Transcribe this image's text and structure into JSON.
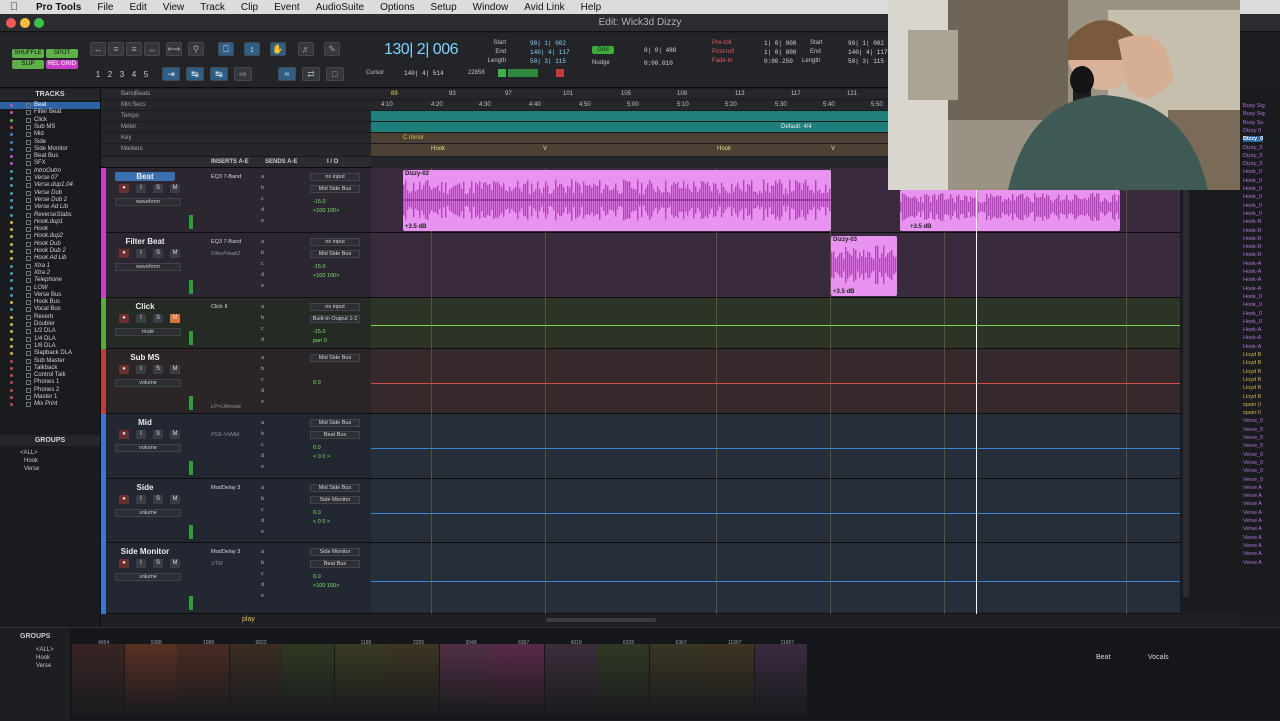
{
  "menu": {
    "app": "Pro Tools",
    "items": [
      "File",
      "Edit",
      "View",
      "Track",
      "Clip",
      "Event",
      "AudioSuite",
      "Options",
      "Setup",
      "Window",
      "Avid Link",
      "Help"
    ]
  },
  "window": {
    "title": "Edit: Wick3d Dizzy"
  },
  "toolbar": {
    "modes": [
      "SHUFFLE",
      "SPOT",
      "SLIP",
      "REL GRID"
    ],
    "zoom_presets": [
      "1",
      "2",
      "3",
      "4",
      "5"
    ],
    "main_counter": "130| 2| 006",
    "cursor_label": "Cursor",
    "cursor_value": "140| 4| 514",
    "sample_value": "22858",
    "sel_labels": [
      "Start",
      "End",
      "Length"
    ],
    "sel_values": [
      "90| 1| 002",
      "140| 4| 117",
      "50| 3| 115"
    ],
    "grid_label": "Grid",
    "grid_value": "0| 0| 480",
    "nudge_label": "Nudge",
    "nudge_value": "0:00.010",
    "preroll_labels": [
      "Pre-roll",
      "Post-roll",
      "Fade-in"
    ],
    "preroll_values": [
      "1| 0| 000",
      "1| 0| 000",
      "0:00.250"
    ],
    "sel2_labels": [
      "Start",
      "End",
      "Length"
    ],
    "sel2_values": [
      "90| 1| 002",
      "140| 4| 117",
      "50| 3| 115"
    ]
  },
  "tracks_panel": {
    "title": "TRACKS",
    "items": [
      {
        "name": "Beat",
        "color": "#d04ad0",
        "selected": true
      },
      {
        "name": "Filter Beat",
        "color": "#d04ad0"
      },
      {
        "name": "Click",
        "color": "#6fbf3a"
      },
      {
        "name": "Sub MS",
        "color": "#c94a4a"
      },
      {
        "name": "Mid",
        "color": "#3f7fd6"
      },
      {
        "name": "Side",
        "color": "#3f7fd6"
      },
      {
        "name": "Side Monitor",
        "color": "#3f7fd6"
      },
      {
        "name": "Beat Bus",
        "color": "#d04ad0"
      },
      {
        "name": "SFX",
        "color": "#d04ad0"
      },
      {
        "name": "IntroOutro",
        "color": "#3aa0b8",
        "italic": true
      },
      {
        "name": "Verse 07",
        "color": "#3aa0b8",
        "italic": true
      },
      {
        "name": "Verse.dup1.04",
        "color": "#3aa0b8",
        "italic": true
      },
      {
        "name": "Verse Dub",
        "color": "#3aa0b8",
        "italic": true
      },
      {
        "name": "Verse Dub 2",
        "color": "#3aa0b8",
        "italic": true
      },
      {
        "name": "Verse Ad Lib",
        "color": "#3aa0b8",
        "italic": true
      },
      {
        "name": "ReverseStabs",
        "color": "#3aa0b8",
        "italic": true
      },
      {
        "name": "Hook.dup1",
        "color": "#d4b83a",
        "italic": true
      },
      {
        "name": "Hook",
        "color": "#d4b83a",
        "italic": true
      },
      {
        "name": "Hook.dup2",
        "color": "#d4b83a",
        "italic": true
      },
      {
        "name": "Hook Dub",
        "color": "#d4b83a",
        "italic": true
      },
      {
        "name": "Hook Dub 2",
        "color": "#d4b83a",
        "italic": true
      },
      {
        "name": "Hook Ad Lib",
        "color": "#d4b83a",
        "italic": true
      },
      {
        "name": "Xtra 1",
        "color": "#3aa0b8",
        "italic": true
      },
      {
        "name": "Xtra 2",
        "color": "#3aa0b8",
        "italic": true
      },
      {
        "name": "Telephone",
        "color": "#3aa0b8",
        "italic": true
      },
      {
        "name": "LOW",
        "color": "#3aa0b8",
        "italic": true
      },
      {
        "name": "Verse Bus",
        "color": "#3aa0b8"
      },
      {
        "name": "Hook Bus",
        "color": "#d4b83a"
      },
      {
        "name": "Vocal Bus",
        "color": "#3aa0b8"
      },
      {
        "name": "Reverb",
        "color": "#d4b83a"
      },
      {
        "name": "Doubler",
        "color": "#d4b83a"
      },
      {
        "name": "1/2 DLA",
        "color": "#d4b83a"
      },
      {
        "name": "1/4 DLA",
        "color": "#d4b83a"
      },
      {
        "name": "1/8 DLA",
        "color": "#d4b83a"
      },
      {
        "name": "Slapback DLA",
        "color": "#d4b83a"
      },
      {
        "name": "Sub Master",
        "color": "#c94a4a"
      },
      {
        "name": "Talkback",
        "color": "#c94a4a"
      },
      {
        "name": "Control Talk",
        "color": "#c94a4a"
      },
      {
        "name": "Phones 1",
        "color": "#c94a4a"
      },
      {
        "name": "Phones 2",
        "color": "#c94a4a"
      },
      {
        "name": "Master 1",
        "color": "#c94a4a"
      },
      {
        "name": "Mix Print",
        "color": "#c94a4a",
        "italic": true
      }
    ]
  },
  "groups_panel": {
    "title": "GROUPS",
    "items": [
      "<ALL>",
      "Hook",
      "Verse"
    ]
  },
  "rulers": {
    "labels": [
      "Bars|Beats",
      "Min:Secs",
      "Tempo",
      "Meter",
      "Key",
      "Markers"
    ],
    "bars": [
      "89",
      "93",
      "97",
      "101",
      "105",
      "109",
      "113",
      "117",
      "121"
    ],
    "times": [
      "4:10",
      "4:20",
      "4:30",
      "4:40",
      "4:50",
      "5:00",
      "5:10",
      "5:20",
      "5:30",
      "5:40",
      "5:50"
    ],
    "meter_text": "Default: 4/4",
    "key_text": "C minor",
    "markers": [
      "Hook",
      "V",
      "Hook",
      "V"
    ]
  },
  "column_heads": [
    "INSERTS A-E",
    "SENDS A-E",
    "I / O"
  ],
  "tracks": [
    {
      "name": "Beat",
      "color": "#c541c8",
      "plugin": "EQ3 7-Band",
      "input": "no input",
      "output": "Mid Side Bus",
      "view": "waveform",
      "vol": "-15.0",
      "pan": "<100  100>",
      "lane_color": "#3a2a3d"
    },
    {
      "name": "Filter Beat",
      "color": "#c541c8",
      "plugin": "EQ3 7-Band",
      "plugin2": "FilterFreak2",
      "input": "no input",
      "output": "Mid Side Bus",
      "view": "waveform",
      "vol": "-15.0",
      "pan": "<100  100>",
      "lane_color": "#3a2a3d"
    },
    {
      "name": "Click",
      "color": "#5fa83a",
      "plugin": "Click II",
      "input": "no input",
      "output": "Built-In Output 1-2",
      "view": "mute",
      "vol": "-15.0",
      "pan": "pan    0",
      "lane_color": "#2c3327"
    },
    {
      "name": "Sub MS",
      "color": "#b84040",
      "plugin": "",
      "plugin2": "LP+Ultimate",
      "input": "Mid Side Bus",
      "output": "",
      "view": "volume",
      "vol": "0.0",
      "pan": "",
      "lane_color": "#35292b"
    },
    {
      "name": "Mid",
      "color": "#3a78c8",
      "plugin": "",
      "plugin2": "PSE-VxMid",
      "input": "Mid Side Bus",
      "output": "Beat Bus",
      "view": "volume",
      "vol": "0.0",
      "pan": "< 0  0 >",
      "lane_color": "#262e3a"
    },
    {
      "name": "Side",
      "color": "#3a78c8",
      "plugin": "ModDelay 3",
      "input": "Mid Side Bus",
      "output": "Side Monitor",
      "view": "volume",
      "vol": "0.0",
      "pan": "< 0  0 >",
      "lane_color": "#262e3a"
    },
    {
      "name": "Side Monitor",
      "color": "#3a78c8",
      "plugin": "ModDelay 3",
      "plugin2": "VTM",
      "input": "Side Monitor",
      "output": "Beat Bus",
      "view": "volume",
      "vol": "0.0",
      "pan": "<100  100>",
      "lane_color": "#262e3a"
    }
  ],
  "clips": [
    {
      "name": "Dizzy-02",
      "gain": "+3.5 dB"
    },
    {
      "name": "Dizzy-03",
      "gain": "+3.5 dB"
    },
    {
      "name": "",
      "gain": "+3.5 dB"
    }
  ],
  "right_list": {
    "items": [
      {
        "t": "Busy Sig",
        "c": "#b574d6"
      },
      {
        "t": "Busy Sig",
        "c": "#b574d6"
      },
      {
        "t": "Busy Su",
        "c": "#b574d6"
      },
      {
        "t": "Dizzy (I",
        "c": "#b574d6"
      },
      {
        "t": "Dizzy_0",
        "c": "#fff",
        "sel": true
      },
      {
        "t": "Dizzy_0",
        "c": "#b574d6"
      },
      {
        "t": "Dizzy_0",
        "c": "#b574d6"
      },
      {
        "t": "Dizzy_0",
        "c": "#b574d6"
      },
      {
        "t": "Hook_0",
        "c": "#b574d6"
      },
      {
        "t": "Hook_0",
        "c": "#b574d6"
      },
      {
        "t": "Hook_0",
        "c": "#b574d6"
      },
      {
        "t": "Hook_0",
        "c": "#b574d6"
      },
      {
        "t": "Hook_0",
        "c": "#b574d6"
      },
      {
        "t": "Hook_0",
        "c": "#b574d6"
      },
      {
        "t": "Hook-R",
        "c": "#b574d6"
      },
      {
        "t": "Hook-R",
        "c": "#b574d6"
      },
      {
        "t": "Hook-R",
        "c": "#b574d6"
      },
      {
        "t": "Hook-R",
        "c": "#b574d6"
      },
      {
        "t": "Hook-R",
        "c": "#b574d6"
      },
      {
        "t": "Hook-A",
        "c": "#b574d6"
      },
      {
        "t": "Hook-A",
        "c": "#b574d6"
      },
      {
        "t": "Hook-A",
        "c": "#b574d6"
      },
      {
        "t": "Hook-A",
        "c": "#b574d6"
      },
      {
        "t": "Hook_0",
        "c": "#b574d6"
      },
      {
        "t": "Hook_0",
        "c": "#b574d6"
      },
      {
        "t": "Hook_0",
        "c": "#b574d6"
      },
      {
        "t": "Hook_0",
        "c": "#b574d6"
      },
      {
        "t": "Hook-A",
        "c": "#b574d6"
      },
      {
        "t": "Hook-A",
        "c": "#b574d6"
      },
      {
        "t": "Hook-A",
        "c": "#b574d6"
      },
      {
        "t": "Lloyd B",
        "c": "#d6b04a"
      },
      {
        "t": "Lloyd B",
        "c": "#d6b04a"
      },
      {
        "t": "Lloyd B",
        "c": "#d6b04a"
      },
      {
        "t": "Lloyd B",
        "c": "#d6b04a"
      },
      {
        "t": "Lloyd B",
        "c": "#d6b04a"
      },
      {
        "t": "Lloyd B",
        "c": "#d6b04a"
      },
      {
        "t": "spain (I",
        "c": "#d6b04a"
      },
      {
        "t": "spain-0",
        "c": "#d6b04a"
      },
      {
        "t": "Verse_0",
        "c": "#b574d6"
      },
      {
        "t": "Verse_0",
        "c": "#b574d6"
      },
      {
        "t": "Verse_0",
        "c": "#b574d6"
      },
      {
        "t": "Verse_0",
        "c": "#b574d6"
      },
      {
        "t": "Verse_0",
        "c": "#b574d6"
      },
      {
        "t": "Verse_0",
        "c": "#b574d6"
      },
      {
        "t": "Verse_0",
        "c": "#b574d6"
      },
      {
        "t": "Verse_0",
        "c": "#b574d6"
      },
      {
        "t": "Verse A",
        "c": "#b574d6"
      },
      {
        "t": "Verse A",
        "c": "#b574d6"
      },
      {
        "t": "Verse A",
        "c": "#b574d6"
      },
      {
        "t": "Verse A",
        "c": "#b574d6"
      },
      {
        "t": "Verse A",
        "c": "#b574d6"
      },
      {
        "t": "Verse A",
        "c": "#b574d6"
      },
      {
        "t": "Verse A",
        "c": "#b574d6"
      },
      {
        "t": "Verse A",
        "c": "#b574d6"
      },
      {
        "t": "Verse A",
        "c": "#b574d6"
      },
      {
        "t": "Verse A",
        "c": "#b574d6"
      }
    ]
  },
  "footer": {
    "play_label": "play"
  },
  "mixer": {
    "groups_title": "GROUPS",
    "groups": [
      "<ALL>",
      "Hook",
      "Verse"
    ],
    "labels": [
      "Beat",
      "Vocals"
    ],
    "values": [
      "4654",
      "1088",
      "1088",
      "6822",
      "",
      "1189",
      "2255",
      "2048",
      "6367",
      "4319",
      "6335",
      "6367",
      "11667",
      "11667"
    ]
  }
}
